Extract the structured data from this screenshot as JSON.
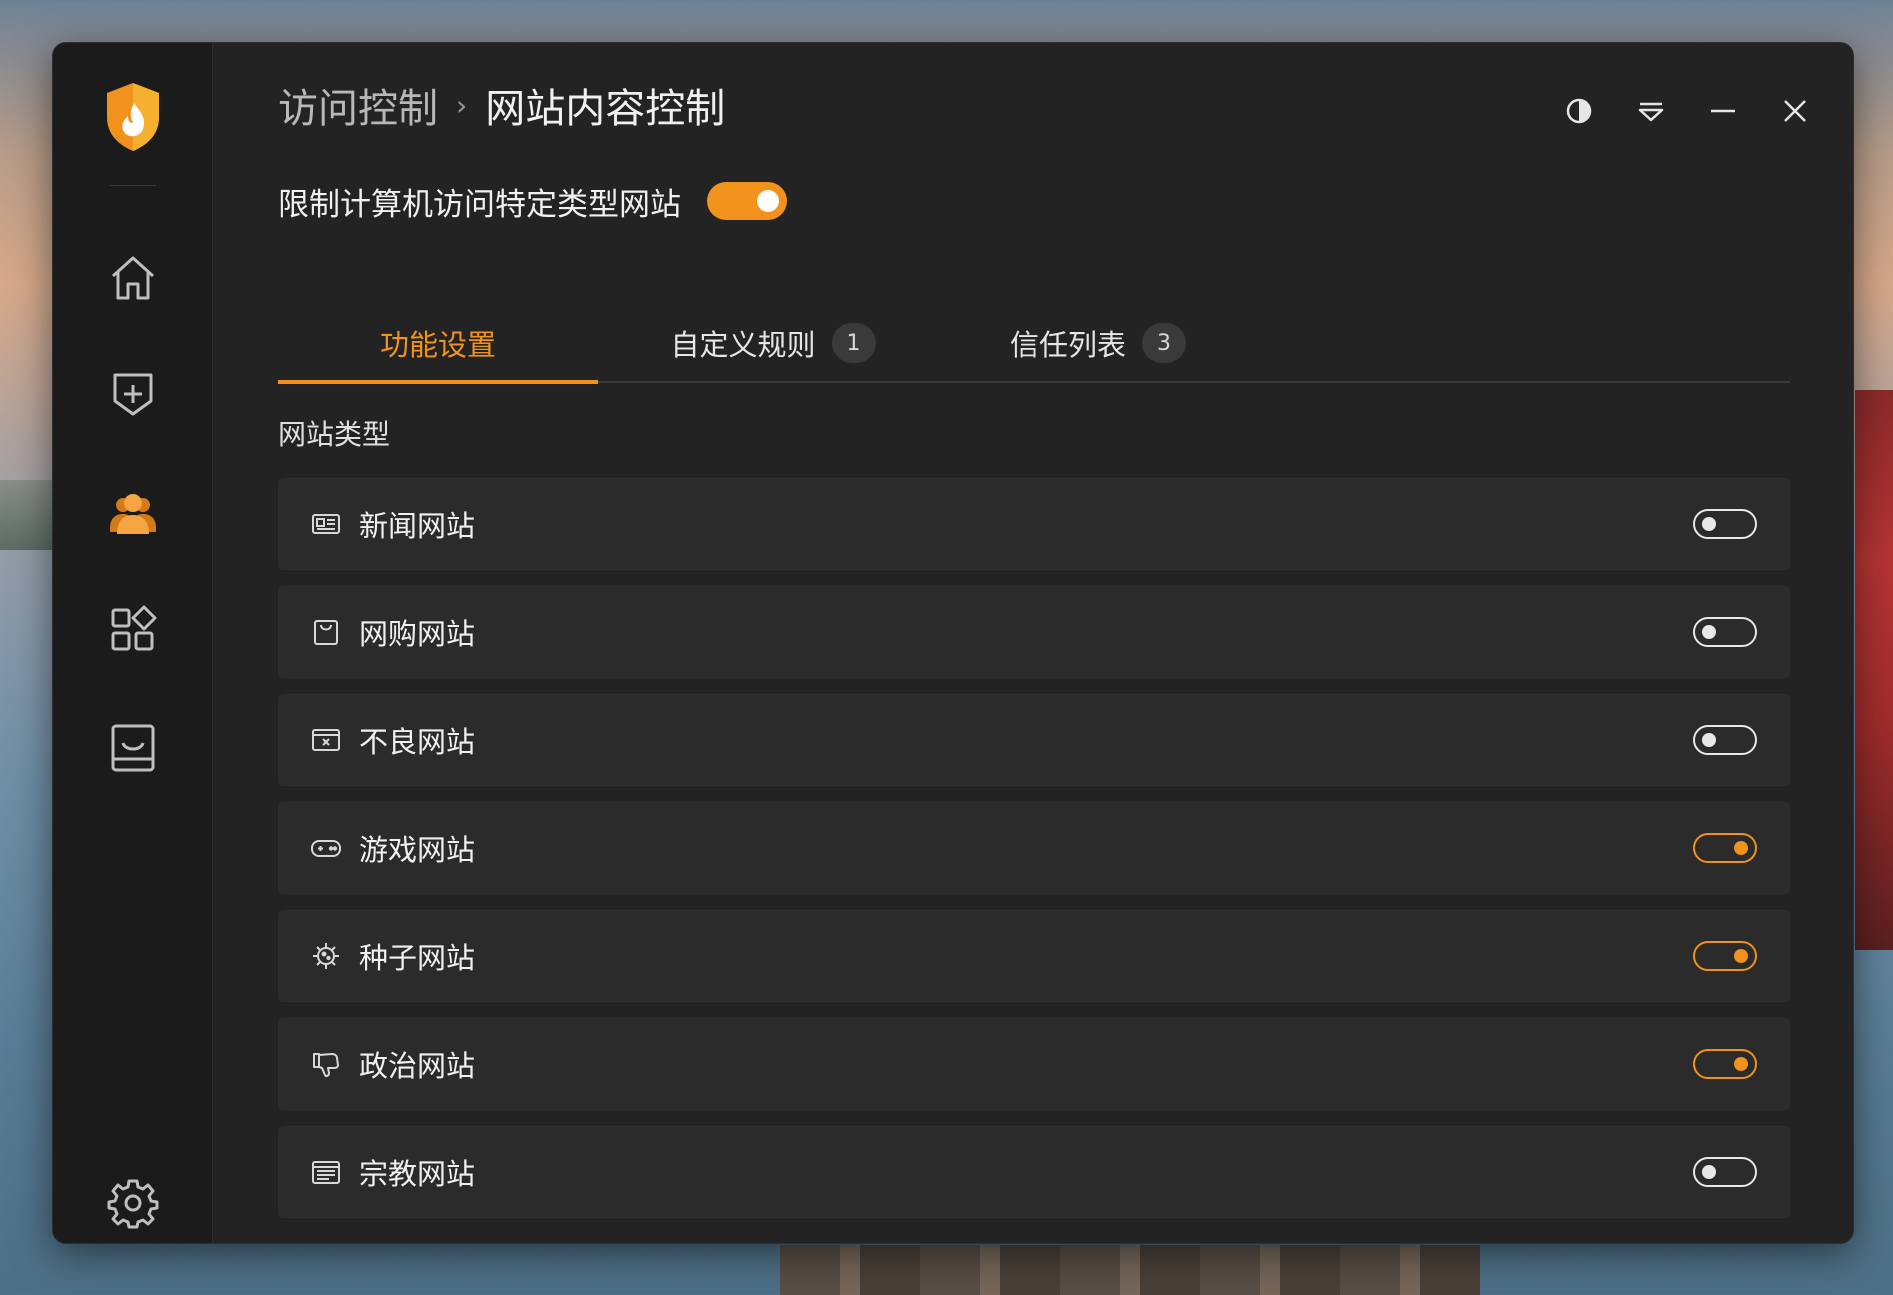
{
  "breadcrumb": {
    "parent": "访问控制",
    "separator": "›",
    "current": "网站内容控制"
  },
  "master": {
    "label": "限制计算机访问特定类型网站",
    "enabled": true
  },
  "tabs": [
    {
      "label": "功能设置",
      "active": true
    },
    {
      "label": "自定义规则",
      "badge": "1",
      "active": false
    },
    {
      "label": "信任列表",
      "badge": "3",
      "active": false
    }
  ],
  "section": {
    "label": "网站类型"
  },
  "categories": [
    {
      "label": "新闻网站",
      "icon": "news-icon",
      "enabled": false
    },
    {
      "label": "网购网站",
      "icon": "shopping-bag-icon",
      "enabled": false
    },
    {
      "label": "不良网站",
      "icon": "blocked-window-icon",
      "enabled": false
    },
    {
      "label": "游戏网站",
      "icon": "gamepad-icon",
      "enabled": true
    },
    {
      "label": "种子网站",
      "icon": "virus-seed-icon",
      "enabled": true
    },
    {
      "label": "政治网站",
      "icon": "thumbs-down-icon",
      "enabled": true
    },
    {
      "label": "宗教网站",
      "icon": "document-list-icon",
      "enabled": false
    }
  ],
  "theme": {
    "accent": "#f0921c",
    "background": "#232323",
    "sidebar": "#1b1b1b",
    "row": "#2b2b2b"
  }
}
